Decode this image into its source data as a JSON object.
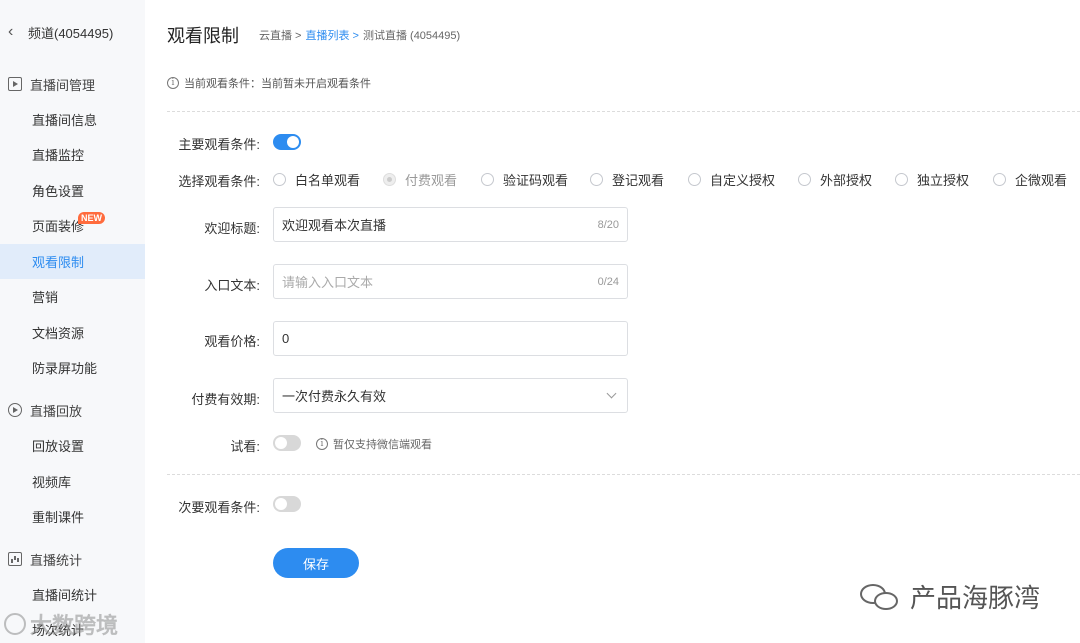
{
  "sidebar": {
    "back_label": "频道(4054495)",
    "groups": [
      {
        "label": "直播间管理"
      },
      {
        "label": "直播回放"
      },
      {
        "label": "直播统计"
      }
    ],
    "items": [
      {
        "label": "直播间信息"
      },
      {
        "label": "直播监控"
      },
      {
        "label": "角色设置"
      },
      {
        "label": "页面装修",
        "badge": "NEW"
      },
      {
        "label": "观看限制",
        "active": true
      },
      {
        "label": "营销"
      },
      {
        "label": "文档资源"
      },
      {
        "label": "防录屏功能"
      },
      {
        "label": "回放设置"
      },
      {
        "label": "视频库"
      },
      {
        "label": "重制课件"
      },
      {
        "label": "直播间统计"
      },
      {
        "label": "场次统计"
      }
    ]
  },
  "header": {
    "title": "观看限制",
    "breadcrumb": [
      "云直播 >",
      "直播列表 >",
      "测试直播 (4054495)"
    ]
  },
  "notice": "当前观看条件：当前暂未开启观看条件",
  "form": {
    "primary_label": "主要观看条件:",
    "primary_on": true,
    "select_label": "选择观看条件:",
    "options": [
      "白名单观看",
      "付费观看",
      "验证码观看",
      "登记观看",
      "自定义授权",
      "外部授权",
      "独立授权",
      "企微观看"
    ],
    "selected_option": "付费观看",
    "welcome_label": "欢迎标题:",
    "welcome_value": "欢迎观看本次直播",
    "welcome_count": "8/20",
    "entry_label": "入口文本:",
    "entry_placeholder": "请输入入口文本",
    "entry_count": "0/24",
    "price_label": "观看价格:",
    "price_value": "0",
    "validity_label": "付费有效期:",
    "validity_value": "一次付费永久有效",
    "trial_label": "试看:",
    "trial_on": false,
    "trial_hint": "暂仅支持微信端观看",
    "secondary_label": "次要观看条件:",
    "secondary_on": false,
    "save_label": "保存"
  },
  "watermarks": {
    "right": "产品海豚湾",
    "left": "大数跨境"
  },
  "colors": {
    "accent": "#2d8cf0",
    "sidebar_bg": "#f7f8fa",
    "active_bg": "#e1ecfa",
    "badge": "#ff6b3d"
  }
}
